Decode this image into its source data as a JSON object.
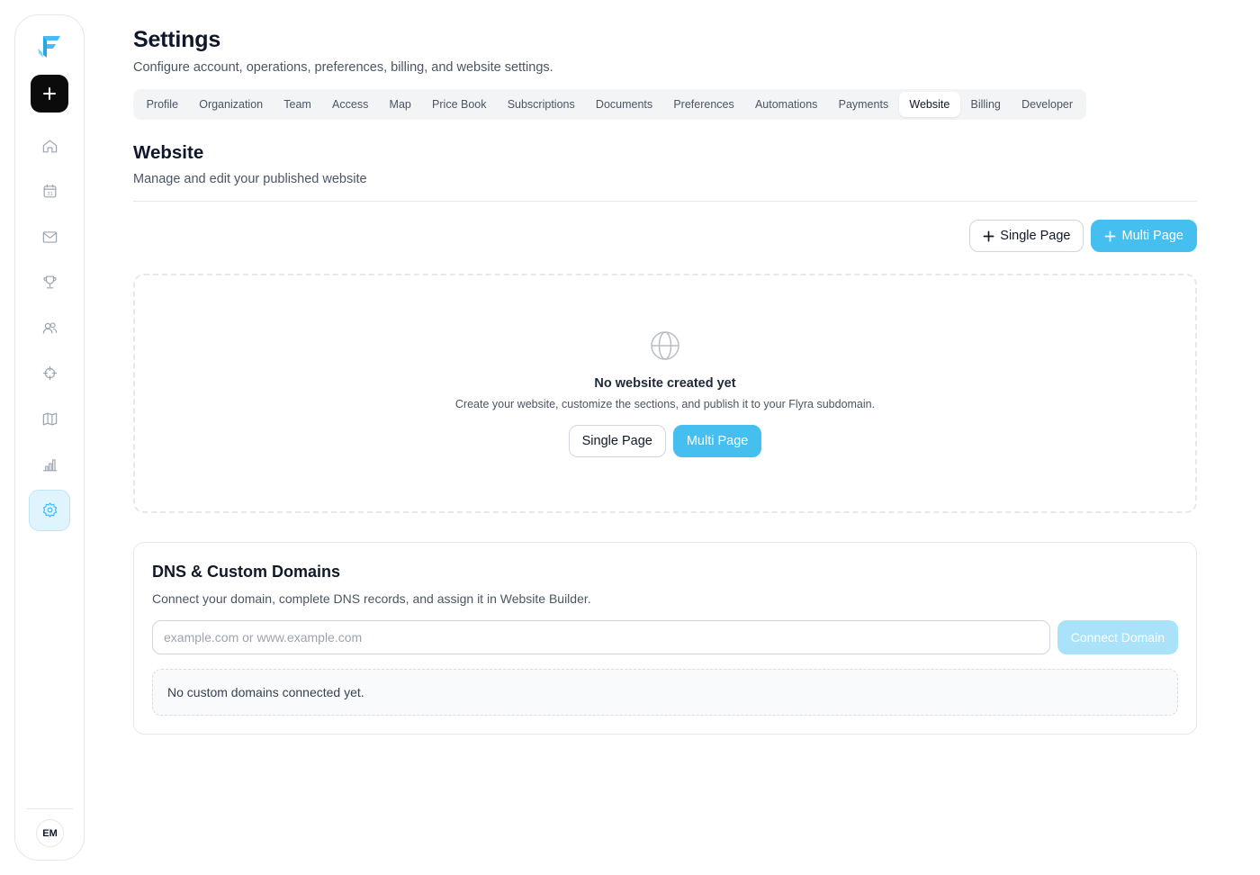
{
  "colors": {
    "accent": "#45bff0",
    "accent_light": "#a9e2f9",
    "active_nav_bg": "#e0f4fd",
    "dark_button": "#0b0b0c"
  },
  "sidebar": {
    "logo_icon": "flyra-logo-icon",
    "add_icon": "plus-icon",
    "items": [
      {
        "icon": "home-icon",
        "active": false
      },
      {
        "icon": "calendar-icon",
        "active": false
      },
      {
        "icon": "mail-icon",
        "active": false
      },
      {
        "icon": "trophy-icon",
        "active": false
      },
      {
        "icon": "users-icon",
        "active": false
      },
      {
        "icon": "crosshair-icon",
        "active": false
      },
      {
        "icon": "map-icon",
        "active": false
      },
      {
        "icon": "bar-chart-icon",
        "active": false
      },
      {
        "icon": "settings-icon",
        "active": true
      }
    ],
    "avatar_initials": "EM"
  },
  "header": {
    "title": "Settings",
    "subtitle": "Configure account, operations, preferences, billing, and website settings."
  },
  "tabs": [
    {
      "label": "Profile"
    },
    {
      "label": "Organization"
    },
    {
      "label": "Team"
    },
    {
      "label": "Access"
    },
    {
      "label": "Map"
    },
    {
      "label": "Price Book"
    },
    {
      "label": "Subscriptions"
    },
    {
      "label": "Documents"
    },
    {
      "label": "Preferences"
    },
    {
      "label": "Automations"
    },
    {
      "label": "Payments"
    },
    {
      "label": "Website",
      "active": true
    },
    {
      "label": "Billing"
    },
    {
      "label": "Developer"
    }
  ],
  "website": {
    "title": "Website",
    "subtitle": "Manage and edit your published website",
    "single_page_label": "Single Page",
    "multi_page_label": "Multi Page",
    "empty": {
      "icon": "globe-icon",
      "title": "No website created yet",
      "subtitle": "Create your website, customize the sections, and publish it to your Flyra subdomain.",
      "single_page_label": "Single Page",
      "multi_page_label": "Multi Page"
    }
  },
  "dns": {
    "title": "DNS & Custom Domains",
    "subtitle": "Connect your domain, complete DNS records, and assign it in Website Builder.",
    "input_placeholder": "example.com or www.example.com",
    "input_value": "",
    "connect_label": "Connect Domain",
    "empty_message": "No custom domains connected yet."
  }
}
